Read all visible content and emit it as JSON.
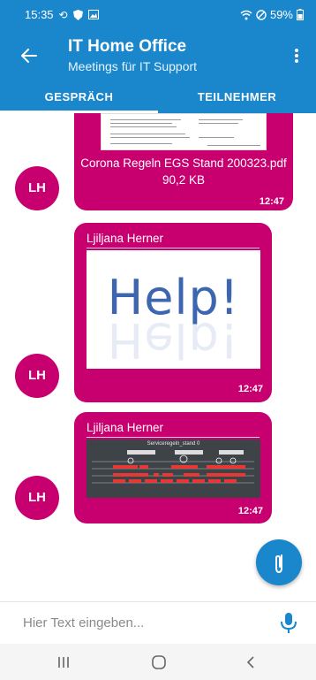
{
  "status": {
    "time": "15:35",
    "battery": "59%"
  },
  "header": {
    "title": "IT Home Office",
    "subtitle": "Meetings für IT Support",
    "tabs": [
      {
        "label": "GESPRÄCH"
      },
      {
        "label": "TEILNEHMER"
      }
    ]
  },
  "messages": [
    {
      "avatar": "LH",
      "file_name": "Corona Regeln EGS Stand 200323.pdf",
      "file_size": "90,2 KB",
      "time": "12:47"
    },
    {
      "avatar": "LH",
      "sender": "Ljiljana Herner",
      "image_text": "Help!",
      "time": "12:47"
    },
    {
      "avatar": "LH",
      "sender": "Ljiljana Herner",
      "image_title": "Serviceregeln_stand 0",
      "time": "12:47"
    }
  ],
  "composer": {
    "placeholder": "Hier Text eingeben..."
  },
  "colors": {
    "primary": "#1a86cc",
    "accent": "#c8006f"
  }
}
